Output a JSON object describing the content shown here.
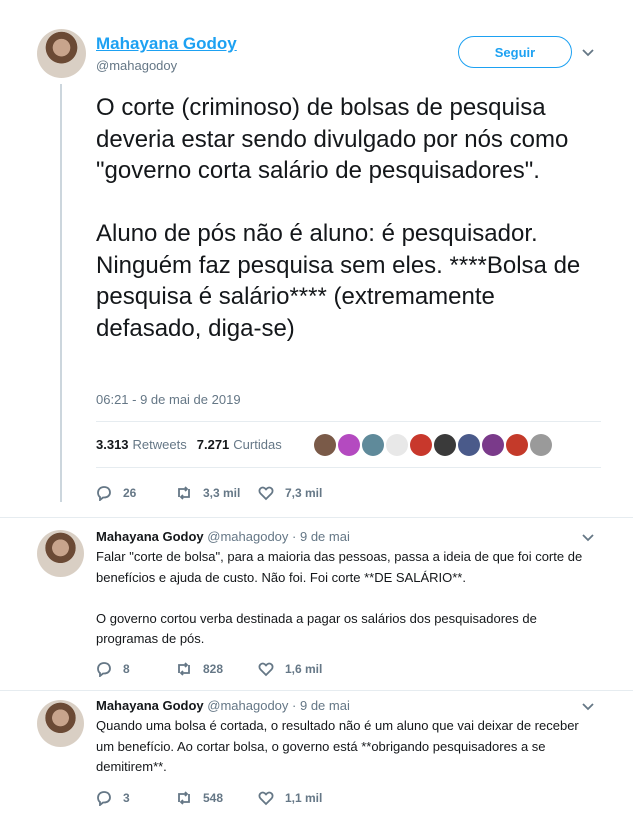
{
  "tweet": {
    "author_name": "Mahayana Godoy",
    "author_handle": "@mahagodoy",
    "follow_label": "Seguir",
    "text": "O corte (criminoso) de bolsas de pesquisa deveria estar sendo divulgado por nós como \"governo corta salário de pesquisadores\".\n\nAluno de pós não é aluno: é pesquisador. Ninguém faz pesquisa sem eles. ****Bolsa de pesquisa é salário**** (extremamente defasado, diga-se)",
    "timestamp": "06:21 - 9 de mai de 2019",
    "retweets_count": "3.313",
    "retweets_label": "Retweets",
    "likes_count": "7.271",
    "likes_label": "Curtidas",
    "likers_avatar_colors": [
      "#7a5a48",
      "#b44ac0",
      "#5f8a9a",
      "#e8e8e8",
      "#c8382c",
      "#3a3a3a",
      "#4a5a8a",
      "#7a3a8a",
      "#c43a2a",
      "#9a9a9a"
    ],
    "actions": {
      "replies": "26",
      "retweets": "3,3 mil",
      "likes": "7,3 mil"
    }
  },
  "replies": [
    {
      "author_name": "Mahayana Godoy",
      "author_handle": "@mahagodoy",
      "date": "· 9 de mai",
      "text": "Falar \"corte de bolsa\", para a maioria das pessoas, passa a ideia de que foi corte de benefícios e ajuda de custo. Não foi. Foi corte **DE SALÁRIO**.\n\nO governo cortou verba destinada a pagar os salários dos pesquisadores de programas de pós.",
      "actions": {
        "replies": "8",
        "retweets": "828",
        "likes": "1,6 mil"
      }
    },
    {
      "author_name": "Mahayana Godoy",
      "author_handle": "@mahagodoy",
      "date": "· 9 de mai",
      "text": "Quando uma bolsa é cortada, o resultado não é um aluno que vai deixar de receber um benefício. Ao cortar bolsa, o governo está **obrigando pesquisadores a se demitirem**.",
      "actions": {
        "replies": "3",
        "retweets": "548",
        "likes": "1,1 mil"
      }
    }
  ]
}
